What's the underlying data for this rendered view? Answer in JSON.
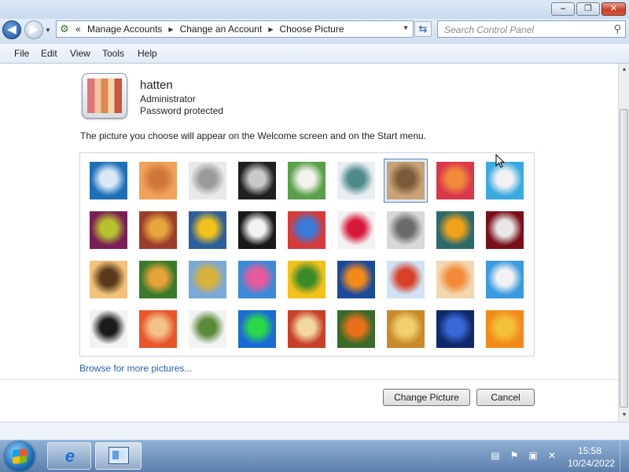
{
  "window": {
    "min_glyph": "–",
    "max_glyph": "❐",
    "close_glyph": "✕"
  },
  "nav": {
    "back_glyph": "◀",
    "fwd_glyph": "▶",
    "breadcrumb_prefix": "«",
    "breadcrumbs": [
      "Manage Accounts",
      "Change an Account",
      "Choose Picture"
    ],
    "search_placeholder": "Search Control Panel"
  },
  "menu": [
    "File",
    "Edit",
    "View",
    "Tools",
    "Help"
  ],
  "user": {
    "name": "hatten",
    "role": "Administrator",
    "status": "Password protected"
  },
  "instruction": "The picture you choose will appear on the Welcome screen and on the Start menu.",
  "pictures": [
    {
      "name": "ferris-wheel",
      "colors": [
        "#1d6fb8",
        "#dbe9f7"
      ]
    },
    {
      "name": "starfish",
      "colors": [
        "#f2a25a",
        "#d0763a"
      ]
    },
    {
      "name": "robot-toy",
      "colors": [
        "#e9e9e9",
        "#9a9a9a"
      ]
    },
    {
      "name": "vinyl-record",
      "colors": [
        "#202020",
        "#c9c9c9"
      ]
    },
    {
      "name": "lucky-cat",
      "colors": [
        "#5aa04a",
        "#f2f2ee"
      ]
    },
    {
      "name": "gyroscope",
      "colors": [
        "#e8edf2",
        "#4e8a8a"
      ]
    },
    {
      "name": "kitten",
      "colors": [
        "#c9a277",
        "#7a5a3a"
      ],
      "selected": true
    },
    {
      "name": "flower",
      "colors": [
        "#d8384a",
        "#f28a3a"
      ]
    },
    {
      "name": "pinwheel",
      "colors": [
        "#3aa9e0",
        "#f2f2f2"
      ]
    },
    {
      "name": "ball",
      "colors": [
        "#7a1f55",
        "#b7c22e"
      ]
    },
    {
      "name": "stripes",
      "colors": [
        "#9a3d2a",
        "#e8a53d"
      ]
    },
    {
      "name": "leaf",
      "colors": [
        "#2d5f9a",
        "#f2c21a"
      ]
    },
    {
      "name": "dog",
      "colors": [
        "#1a1a1a",
        "#f2f2f2"
      ]
    },
    {
      "name": "crayons",
      "colors": [
        "#d83a3a",
        "#3a7ad8"
      ]
    },
    {
      "name": "star-flower",
      "colors": [
        "#f2f2f2",
        "#d81a3a"
      ]
    },
    {
      "name": "jacks",
      "colors": [
        "#d8d8d8",
        "#6a6a6a"
      ]
    },
    {
      "name": "stairs",
      "colors": [
        "#2d6a6a",
        "#f2a21a"
      ]
    },
    {
      "name": "paper-crane",
      "colors": [
        "#7a0f1a",
        "#e8e8e8"
      ]
    },
    {
      "name": "guitar",
      "colors": [
        "#f2c27a",
        "#5a3a1a"
      ]
    },
    {
      "name": "puppy",
      "colors": [
        "#3a7a2a",
        "#e8a23a"
      ]
    },
    {
      "name": "toy-robot",
      "colors": [
        "#7aa8d8",
        "#d8b23a"
      ]
    },
    {
      "name": "fabric",
      "colors": [
        "#3a8ad8",
        "#e85a9a"
      ]
    },
    {
      "name": "sunflower",
      "colors": [
        "#f2c21a",
        "#3a8a2a"
      ]
    },
    {
      "name": "fish",
      "colors": [
        "#1a4a9a",
        "#f28a1a"
      ]
    },
    {
      "name": "hot-air-balloon",
      "colors": [
        "#cfe3f5",
        "#d8402a"
      ]
    },
    {
      "name": "bird-figure",
      "colors": [
        "#f2d8b0",
        "#f28a3a"
      ]
    },
    {
      "name": "sailboat",
      "colors": [
        "#3a9ae0",
        "#f2f2f2"
      ]
    },
    {
      "name": "soccer-ball",
      "colors": [
        "#f2f2f2",
        "#1a1a1a"
      ]
    },
    {
      "name": "orange-stripes",
      "colors": [
        "#e8552a",
        "#f2c28a"
      ]
    },
    {
      "name": "marbles",
      "colors": [
        "#f2f2f2",
        "#5a8a3a"
      ]
    },
    {
      "name": "green-window",
      "colors": [
        "#1a6ad8",
        "#2ad84a"
      ]
    },
    {
      "name": "tribal-pattern",
      "colors": [
        "#c8402a",
        "#f2d8a0"
      ]
    },
    {
      "name": "butterfly",
      "colors": [
        "#3a6a2a",
        "#e8701a"
      ]
    },
    {
      "name": "shell",
      "colors": [
        "#c88a2a",
        "#f2d070"
      ]
    },
    {
      "name": "lighthouse",
      "colors": [
        "#0f2a6a",
        "#3a6ad8"
      ]
    },
    {
      "name": "daisy",
      "colors": [
        "#f28a1a",
        "#f2c23a"
      ]
    }
  ],
  "browse_link": "Browse for more pictures...",
  "buttons": {
    "change": "Change Picture",
    "cancel": "Cancel"
  },
  "clock": {
    "time": "15:58",
    "date": "10/24/2022"
  }
}
